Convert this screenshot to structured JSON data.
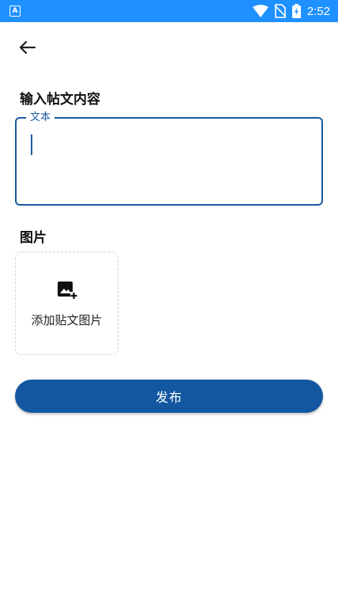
{
  "status_bar": {
    "app_icon_letter": "A",
    "time": "2:52",
    "color": "#1e90ff",
    "icons": [
      "wifi-icon",
      "no-sim-icon",
      "battery-charging-icon"
    ]
  },
  "nav": {
    "back_icon": "arrow-left-icon"
  },
  "form": {
    "content_heading": "输入帖文内容",
    "text_field": {
      "label": "文本",
      "value": "",
      "accent_color": "#1a5aa0"
    },
    "images_heading": "图片",
    "add_image": {
      "label": "添加贴文图片",
      "icon": "add-photo-icon"
    },
    "publish_label": "发布",
    "publish_color": "#1357a0"
  }
}
